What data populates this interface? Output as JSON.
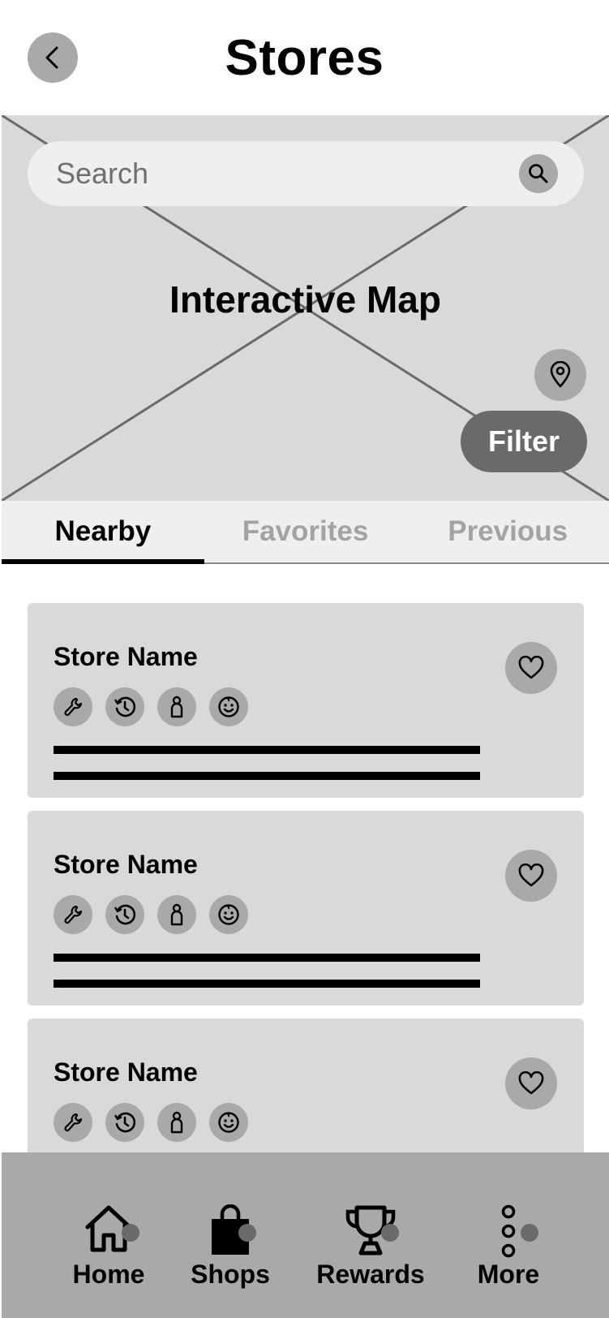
{
  "header": {
    "title": "Stores",
    "back_icon": "chevron-left-icon"
  },
  "map": {
    "label": "Interactive Map",
    "search_placeholder": "Search",
    "filter_label": "Filter"
  },
  "tabs": [
    {
      "label": "Nearby",
      "active": true
    },
    {
      "label": "Favorites",
      "active": false
    },
    {
      "label": "Previous",
      "active": false
    }
  ],
  "stores": [
    {
      "name": "Store Name",
      "services": [
        "wrench-icon",
        "history-icon",
        "person-icon",
        "smiley-icon"
      ]
    },
    {
      "name": "Store Name",
      "services": [
        "wrench-icon",
        "history-icon",
        "person-icon",
        "smiley-icon"
      ]
    },
    {
      "name": "Store Name",
      "services": [
        "wrench-icon",
        "history-icon",
        "person-icon",
        "smiley-icon"
      ]
    }
  ],
  "nav": [
    {
      "label": "Home",
      "icon": "home-icon",
      "active": false
    },
    {
      "label": "Shops",
      "icon": "shopping-bag-icon",
      "active": true
    },
    {
      "label": "Rewards",
      "icon": "trophy-icon",
      "active": false
    },
    {
      "label": "More",
      "icon": "more-icon",
      "active": false
    }
  ],
  "colors": {
    "placeholder_fill": "#d9d9d9",
    "icon_circle": "#a9a9a9",
    "filter_button": "#6a6a6a",
    "nav_background": "#a9a9a9",
    "inactive_tab_text": "#a3a3a3"
  }
}
